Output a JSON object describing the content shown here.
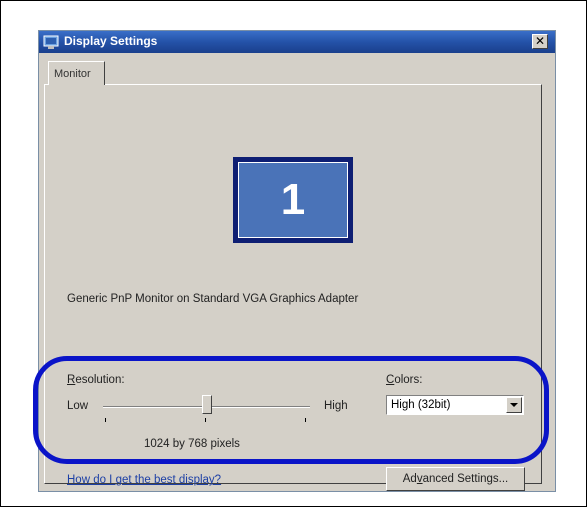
{
  "window": {
    "title": "Display Settings",
    "close_glyph": "✕"
  },
  "tabs": [
    {
      "label": "Monitor",
      "selected": true
    }
  ],
  "monitor": {
    "number": "1",
    "adapter": "Generic PnP Monitor on Standard VGA Graphics Adapter"
  },
  "resolution": {
    "label_prefix_u": "R",
    "label_rest": "esolution:",
    "low_label": "Low",
    "high_label": "High",
    "value_text": "1024 by 768 pixels",
    "slider_position_fraction": 0.5
  },
  "colors": {
    "label_prefix_u": "C",
    "label_rest": "olors:",
    "selected": "High (32bit)"
  },
  "help_link": "How do I get the best display?",
  "advanced_button": {
    "pre": "Ad",
    "u": "v",
    "post": "anced Settings..."
  },
  "highlight": {
    "color": "#0a14c8"
  },
  "icons": {
    "title": "display-settings-icon",
    "close": "close-icon",
    "dropdown": "chevron-down-icon"
  }
}
